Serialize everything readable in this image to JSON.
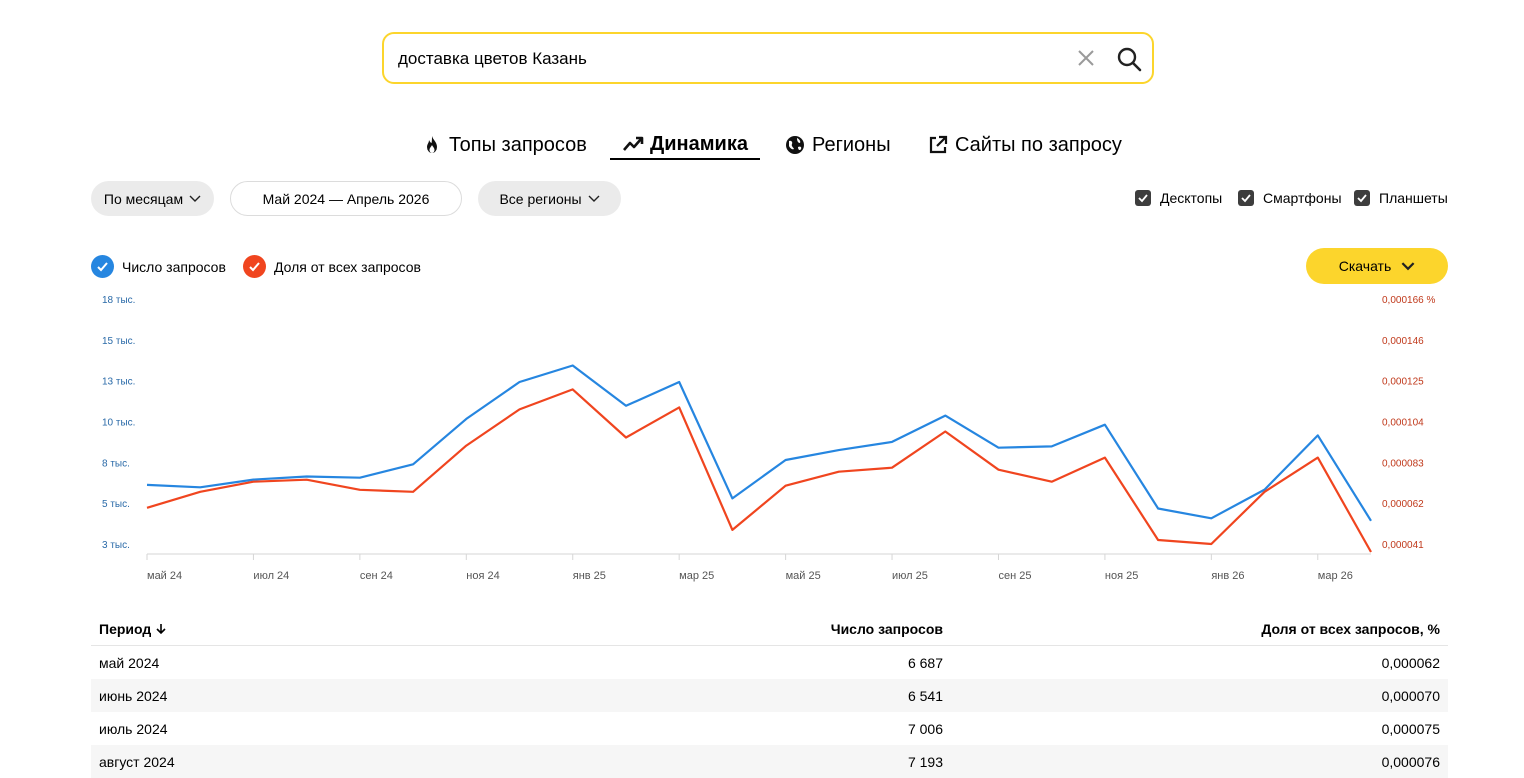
{
  "search": {
    "value": "доставка цветов Казань"
  },
  "tabs": [
    {
      "label": "Топы запросов",
      "icon": "fire-icon"
    },
    {
      "label": "Динамика",
      "icon": "trend-icon",
      "active": true
    },
    {
      "label": "Регионы",
      "icon": "globe-icon"
    },
    {
      "label": "Сайты по запросу",
      "icon": "external-link-icon"
    }
  ],
  "filters": {
    "grouping": "По месяцам",
    "period": "Май 2024 — Апрель 2026",
    "regions": "Все регионы"
  },
  "devices": [
    {
      "label": "Десктопы",
      "checked": true
    },
    {
      "label": "Смартфоны",
      "checked": true
    },
    {
      "label": "Планшеты",
      "checked": true
    }
  ],
  "legend": [
    {
      "label": "Число запросов",
      "color": "#2686e0"
    },
    {
      "label": "Доля от всех запросов",
      "color": "#f0451f"
    }
  ],
  "download_label": "Скачать",
  "chart_data": {
    "type": "line",
    "x": [
      "май 24",
      "июн 24",
      "июл 24",
      "авг 24",
      "сен 24",
      "окт 24",
      "ноя 24",
      "дек 24",
      "янв 25",
      "фев 25",
      "мар 25",
      "апр 25",
      "май 25",
      "июн 25",
      "июл 25",
      "авг 25",
      "сен 25",
      "окт 25",
      "ноя 25",
      "дек 25",
      "янв 26",
      "фев 26",
      "мар 26",
      "апр 26"
    ],
    "x_tick_labels": [
      "май 24",
      "",
      "июл 24",
      "",
      "сен 24",
      "",
      "ноя 24",
      "",
      "янв 25",
      "",
      "мар 25",
      "",
      "май 25",
      "",
      "июл 25",
      "",
      "сен 25",
      "",
      "ноя 25",
      "",
      "янв 26",
      "",
      "мар 26",
      ""
    ],
    "series": [
      {
        "name": "Число запросов",
        "axis": "left",
        "color": "#2686e0",
        "values": [
          6687,
          6541,
          7006,
          7193,
          7120,
          7939,
          10700,
          12950,
          13950,
          11500,
          12950,
          5860,
          8200,
          8800,
          9300,
          10900,
          8950,
          9030,
          10350,
          5250,
          4650,
          6400,
          9700,
          4500
        ]
      },
      {
        "name": "Доля от всех запросов",
        "axis": "right",
        "color": "#f0451f",
        "values": [
          6.2e-05,
          7e-05,
          7.5e-05,
          7.6e-05,
          7.1e-05,
          7e-05,
          9.3e-05,
          0.000111,
          0.000121,
          9.7e-05,
          0.000112,
          5.1e-05,
          7.3e-05,
          8e-05,
          8.2e-05,
          0.0001,
          8.1e-05,
          7.5e-05,
          8.7e-05,
          4.6e-05,
          4.4e-05,
          7e-05,
          8.7e-05,
          4e-05
        ]
      }
    ],
    "y_left_ticks": [
      "18 тыс.",
      "15 тыс.",
      "13 тыс.",
      "10 тыс.",
      "8 тыс.",
      "5 тыс.",
      "3 тыс."
    ],
    "y_left_range": [
      2600,
      18000
    ],
    "y_right_ticks": [
      "0,000166 %",
      "0,000146",
      "0,000125",
      "0,000104",
      "0,000083",
      "0,000062",
      "0,000041"
    ],
    "y_right_range": [
      4e-05,
      0.000166
    ]
  },
  "table": {
    "headers": [
      "Период",
      "Число запросов",
      "Доля от всех запросов, %"
    ],
    "rows": [
      [
        "май 2024",
        "6 687",
        "0,000062"
      ],
      [
        "июнь 2024",
        "6 541",
        "0,000070"
      ],
      [
        "июль 2024",
        "7 006",
        "0,000075"
      ],
      [
        "август 2024",
        "7 193",
        "0,000076"
      ]
    ]
  }
}
